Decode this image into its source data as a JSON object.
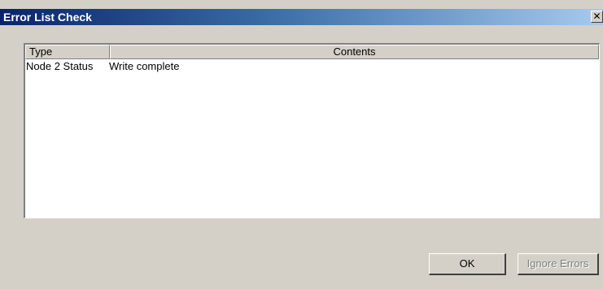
{
  "window": {
    "title": "Error List Check",
    "close_glyph": "✕",
    "close_icon": "close-icon"
  },
  "list": {
    "columns": [
      {
        "label": "Type"
      },
      {
        "label": "Contents"
      }
    ],
    "rows": [
      {
        "type": "Node 2 Status",
        "contents": "Write complete"
      }
    ]
  },
  "buttons": {
    "ok_label": "OK",
    "ignore_label": "Ignore Errors",
    "ignore_enabled": false
  }
}
